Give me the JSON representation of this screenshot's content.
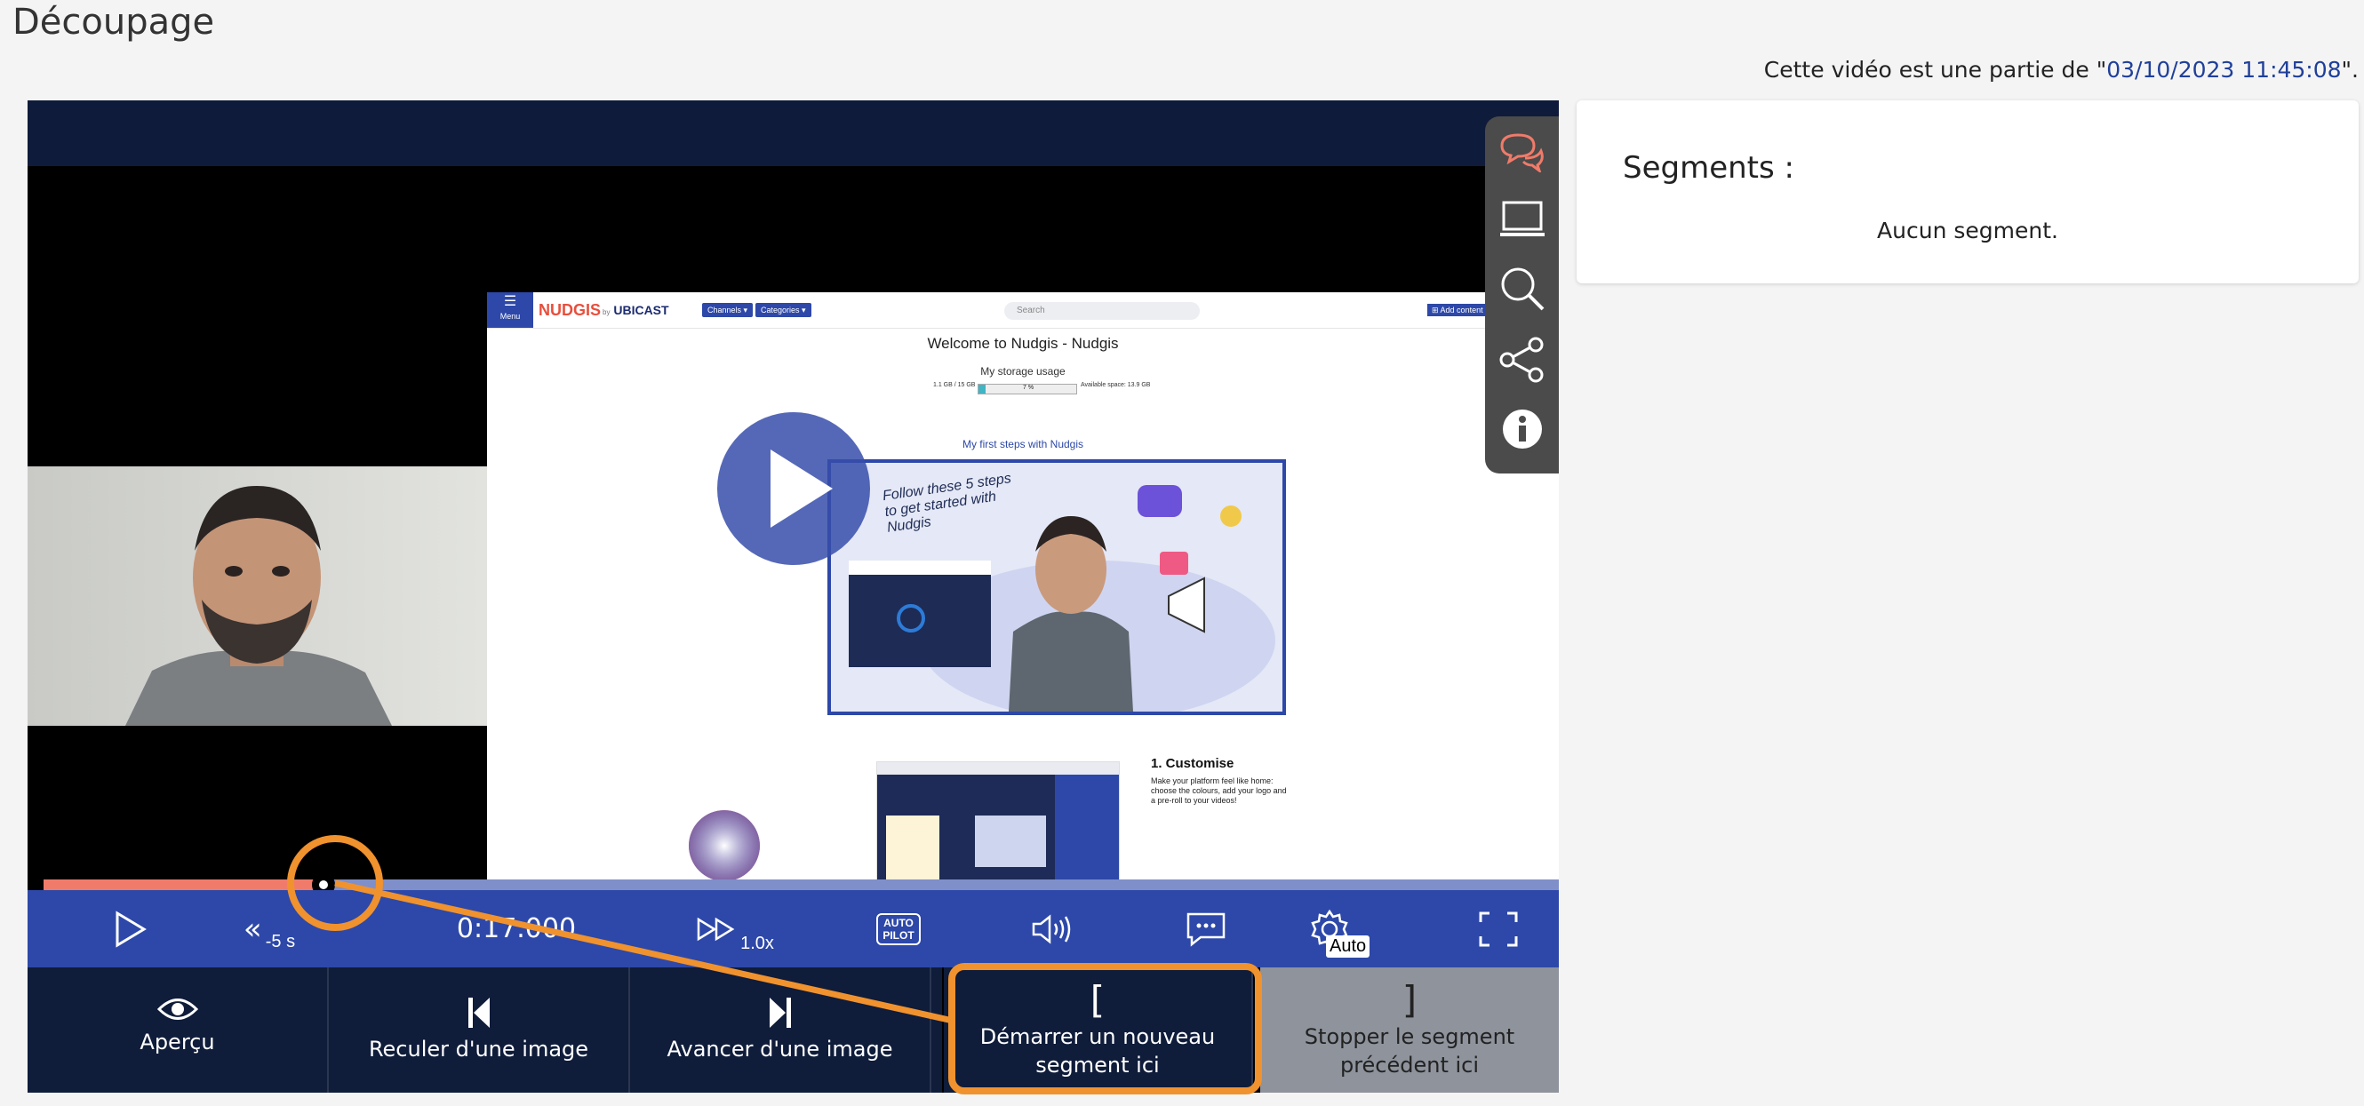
{
  "page": {
    "title": "Découpage",
    "part_of_prefix": "Cette vidéo est une partie de \"",
    "part_of_link": "03/10/2023 11:45:08",
    "part_of_suffix": "\"."
  },
  "video": {
    "screen": {
      "menu_label": "Menu",
      "brand": "NUDGIS",
      "brand_by": "by",
      "brand_company": "UBICAST",
      "channels_label": "Channels ▾",
      "categories_label": "Categories ▾",
      "search_placeholder": "Search",
      "add_content_label": "⊞ Add content ▾",
      "welcome": "Welcome to Nudgis - Nudgis",
      "storage_title": "My storage usage",
      "storage_used": "1.1 GB / 15 GB",
      "storage_percent": "7 %",
      "storage_available": "Available space: 13.9 GB",
      "first_steps": "My first steps with Nudgis",
      "thumb_caption": "Follow these 5 steps to get started with Nudgis",
      "customise_title": "1. Customise",
      "customise_text": "Make your platform feel like home: choose the colours, add your logo and a pre-roll to your videos!"
    },
    "progress": 0.185,
    "time": "0:17.000",
    "rewind_label": "-5 s",
    "speed_label": "1.0x",
    "autopilot_label": "AUTO PILOT",
    "quality_label": "Auto"
  },
  "buttons": {
    "preview": "Aperçu",
    "prev_frame": "Reculer d'une image",
    "next_frame": "Avancer d'une image",
    "start_bracket": "[",
    "start_segment": "Démarrer un nouveau segment ici",
    "stop_bracket": "]",
    "stop_segment": "Stopper le segment précédent ici"
  },
  "segments": {
    "title": "Segments :",
    "empty": "Aucun segment."
  },
  "colors": {
    "accent": "#2d48a8",
    "dark_navy": "#0f1c3a",
    "highlight": "#f0922e",
    "progress_fill": "#f07b6a",
    "link": "#1f3f9a"
  }
}
